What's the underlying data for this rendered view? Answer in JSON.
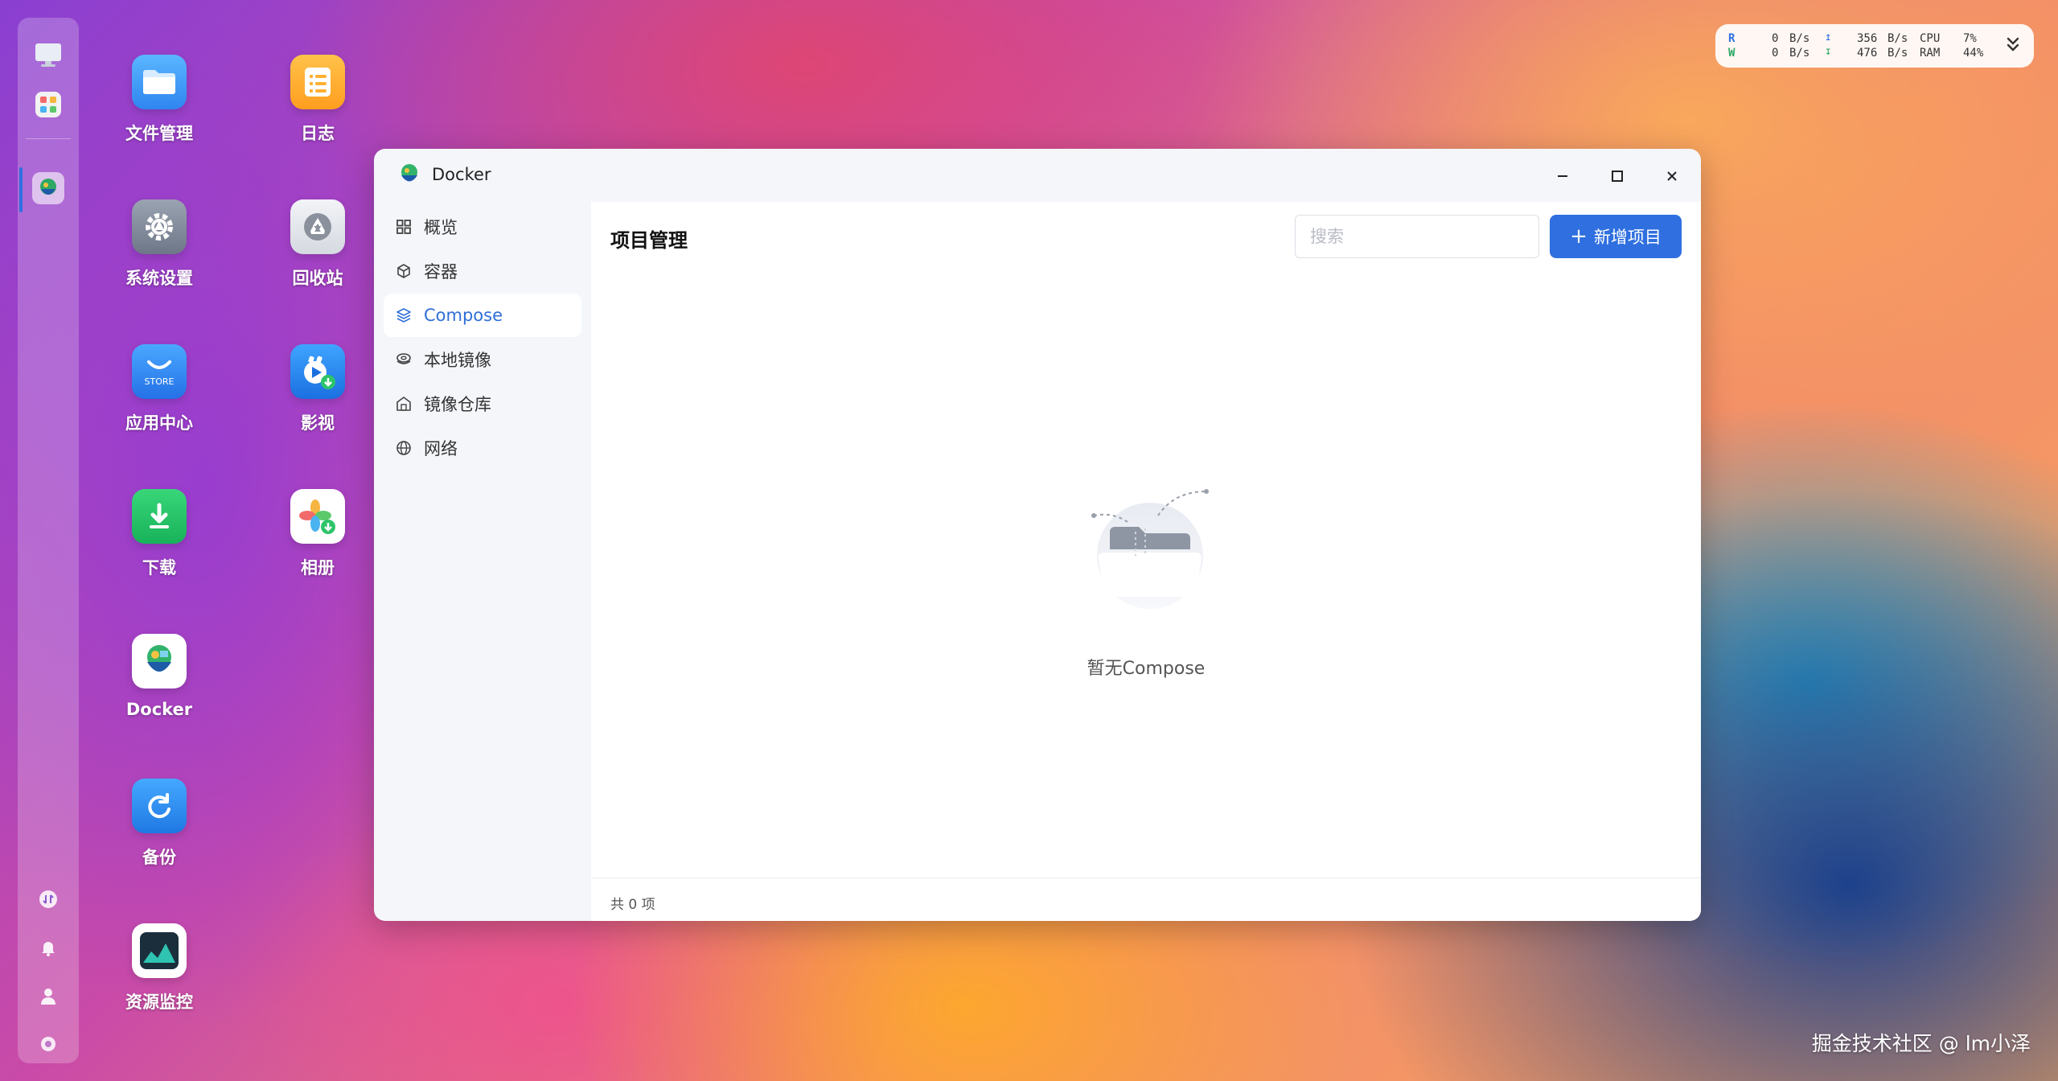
{
  "desktop": {
    "icons": [
      {
        "label": "文件管理",
        "icon": "folder-icon"
      },
      {
        "label": "日志",
        "icon": "log-icon"
      },
      {
        "label": "系统设置",
        "icon": "gear-icon"
      },
      {
        "label": "回收站",
        "icon": "recycle-icon"
      },
      {
        "label": "应用中心",
        "icon": "store-icon",
        "badge": "STORE"
      },
      {
        "label": "影视",
        "icon": "video-icon"
      },
      {
        "label": "下载",
        "icon": "download-icon"
      },
      {
        "label": "相册",
        "icon": "photos-icon"
      },
      {
        "label": "Docker",
        "icon": "docker-icon"
      },
      {
        "label": "备份",
        "icon": "backup-icon"
      },
      {
        "label": "资源监控",
        "icon": "monitor-icon"
      }
    ]
  },
  "monitor": {
    "r_label": "R",
    "w_label": "W",
    "read_speed": "0",
    "write_speed": "0",
    "upload_speed": "356",
    "download_speed": "476",
    "unit": "B/s",
    "cpu_label": "CPU",
    "ram_label": "RAM",
    "cpu_value": "7%",
    "ram_value": "44%"
  },
  "window": {
    "title": "Docker",
    "sidebar": [
      {
        "label": "概览",
        "icon": "grid-icon"
      },
      {
        "label": "容器",
        "icon": "box-icon"
      },
      {
        "label": "Compose",
        "icon": "layers-icon",
        "active": true
      },
      {
        "label": "本地镜像",
        "icon": "disk-icon"
      },
      {
        "label": "镜像仓库",
        "icon": "warehouse-icon"
      },
      {
        "label": "网络",
        "icon": "globe-icon"
      }
    ],
    "main": {
      "title": "项目管理",
      "search_placeholder": "搜索",
      "add_button": "新增项目",
      "empty_text": "暂无Compose",
      "footer_count": "共 0 项"
    }
  },
  "watermark": "掘金技术社区 @ lm小泽",
  "colors": {
    "accent": "#2f6fe0",
    "active_nav_text": "#2f6fd6"
  }
}
